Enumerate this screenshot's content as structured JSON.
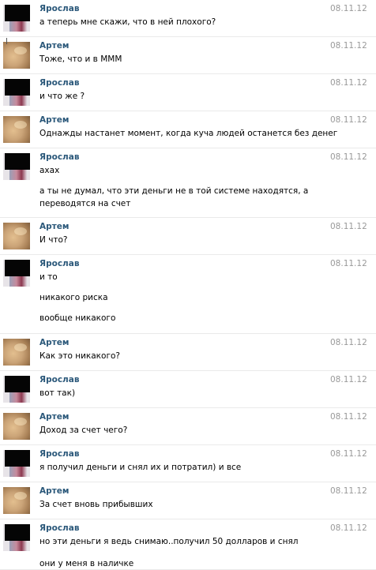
{
  "messages": [
    {
      "author": "Ярослав",
      "date": "08.11.12",
      "avatar": "yaroslav-avatar",
      "lines": [
        "а теперь мне скажи, что в ней плохого?"
      ]
    },
    {
      "author": "Артем",
      "date": "08.11.12",
      "avatar": "artem-avatar",
      "lines": [
        "Тоже, что и в МММ"
      ]
    },
    {
      "author": "Ярослав",
      "date": "08.11.12",
      "avatar": "yaroslav-avatar",
      "lines": [
        "и что же ?"
      ]
    },
    {
      "author": "Артем",
      "date": "08.11.12",
      "avatar": "artem-avatar",
      "lines": [
        "Однажды настанет момент, когда куча людей останется без денег"
      ]
    },
    {
      "author": "Ярослав",
      "date": "08.11.12",
      "avatar": "yaroslav-avatar",
      "lines": [
        "ахах",
        "а ты не думал, что эти деньги не в той системе находятся, а",
        "переводятся на счет"
      ]
    },
    {
      "author": "Артем",
      "date": "08.11.12",
      "avatar": "artem-avatar",
      "lines": [
        "И что?"
      ]
    },
    {
      "author": "Ярослав",
      "date": "08.11.12",
      "avatar": "yaroslav-avatar",
      "lines": [
        "и то",
        "никакого риска",
        "вообще никакого"
      ]
    },
    {
      "author": "Артем",
      "date": "08.11.12",
      "avatar": "artem-avatar",
      "lines": [
        "Как это никакого?"
      ]
    },
    {
      "author": "Ярослав",
      "date": "08.11.12",
      "avatar": "yaroslav-avatar",
      "lines": [
        "вот так)"
      ]
    },
    {
      "author": "Артем",
      "date": "08.11.12",
      "avatar": "artem-avatar",
      "lines": [
        "Доход за счет чего?"
      ]
    },
    {
      "author": "Ярослав",
      "date": "08.11.12",
      "avatar": "yaroslav-avatar",
      "lines": [
        "я получил деньги и снял их и потратил) и все"
      ]
    },
    {
      "author": "Артем",
      "date": "08.11.12",
      "avatar": "artem-avatar",
      "lines": [
        "За счет вновь прибывших"
      ]
    },
    {
      "author": "Ярослав",
      "date": "08.11.12",
      "avatar": "yaroslav-avatar",
      "lines": [
        "но эти деньги я ведь снимаю..получил 50 долларов и снял",
        "они у меня в наличке"
      ]
    }
  ],
  "colors": {
    "author": "#2b587a",
    "date": "#999999",
    "text": "#000000"
  }
}
